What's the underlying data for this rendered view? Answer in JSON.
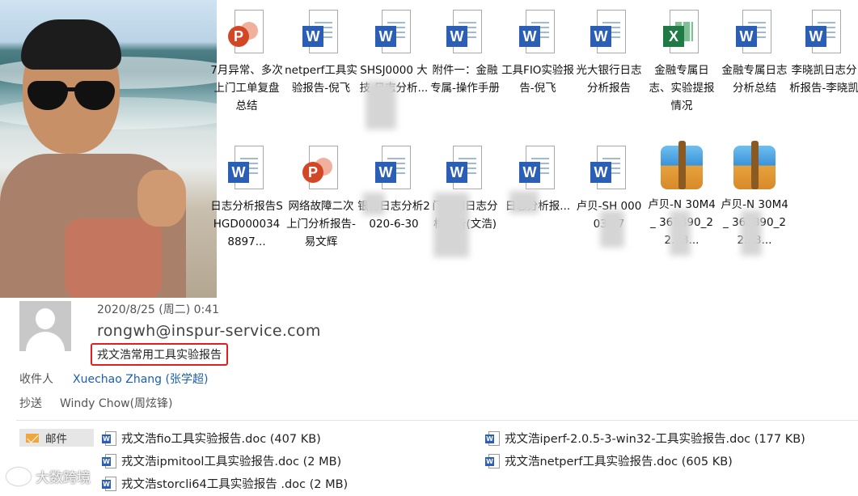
{
  "desktop": {
    "icons": [
      {
        "type": "ppt",
        "label": "7月异常、多次上门工单复盘总结"
      },
      {
        "type": "word",
        "label": "netperf工具实验报告-倪飞"
      },
      {
        "type": "word",
        "label": "SHSJ0000 大 技 日志分析..."
      },
      {
        "type": "word",
        "label": "附件一：金融专属-操作手册"
      },
      {
        "type": "word",
        "label": "工具FIO实验报告-倪飞"
      },
      {
        "type": "word",
        "label": "光大银行日志分析报告"
      },
      {
        "type": "excel",
        "label": "金融专属日志、实验提报情况"
      },
      {
        "type": "word",
        "label": "金融专属日志分析总结"
      },
      {
        "type": "word",
        "label": "李晓凯日志分析报告-李晓凯"
      },
      {
        "type": "word",
        "label": "日志分析报告SHGD0000348897..."
      },
      {
        "type": "ppt",
        "label": "网络故障二次上门分析报告-易文辉"
      },
      {
        "type": "word",
        "label": "银行日志分析2020-6-30"
      },
      {
        "type": "word",
        "label": "门信同日志分析报告(文浩)"
      },
      {
        "type": "word",
        "label": "日志分析报..."
      },
      {
        "type": "word",
        "label": "卢贝-SH 000 03 37"
      },
      {
        "type": "archive",
        "label": "卢贝-N 30M4_ 367890_22.23..."
      },
      {
        "type": "archive",
        "label": "卢贝-N 30M4_ 367890_22.23..."
      }
    ]
  },
  "email": {
    "date": "2020/8/25 (周二) 0:41",
    "sender": "rongwh@inspur-service.com",
    "subject": "戎文浩常用工具实验报告",
    "to_label": "收件人",
    "to_value": "Xuechao Zhang (张学超)",
    "cc_label": "抄送",
    "cc_value": "Windy Chow(周炫锋)",
    "mail_tab": "邮件",
    "attachments": [
      {
        "name": "戎文浩fio工具实验报告.doc (407 KB)"
      },
      {
        "name": "戎文浩iperf-2.0.5-3-win32-工具实验报告.doc (177 KB)"
      },
      {
        "name": "戎文浩ipmitool工具实验报告.doc (2 MB)"
      },
      {
        "name": "戎文浩netperf工具实验报告.doc (605 KB)"
      },
      {
        "name": "戎文浩storcli64工具实验报告  .doc (2 MB)"
      }
    ]
  },
  "watermark": {
    "text": "大数跨境"
  },
  "colors": {
    "subject_border": "#e02020",
    "link": "#1a5fb4",
    "word": "#2b5eb5",
    "ppt": "#d24726",
    "excel": "#1f7a45"
  }
}
